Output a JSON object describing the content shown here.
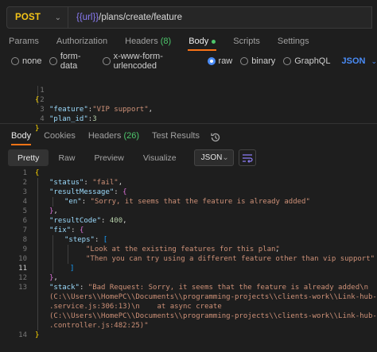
{
  "request": {
    "method": "POST",
    "url_variable": "{{url}}",
    "url_path": "/plans/create/feature"
  },
  "request_tabs": [
    {
      "label": "Params"
    },
    {
      "label": "Authorization"
    },
    {
      "label": "Headers",
      "count": "(8)"
    },
    {
      "label": "Body",
      "active": true
    },
    {
      "label": "Scripts"
    },
    {
      "label": "Settings"
    }
  ],
  "body_types": [
    "none",
    "form-data",
    "x-www-form-urlencoded",
    "raw",
    "binary",
    "GraphQL"
  ],
  "body_type_selected": "raw",
  "body_format": "JSON",
  "request_body": [
    {
      "n": "1",
      "t": "{"
    },
    {
      "n": "2",
      "key": "\"feature\"",
      "val": "\"VIP support\"",
      "end": ","
    },
    {
      "n": "3",
      "key": "\"plan_id\"",
      "val": "3",
      "end": ""
    },
    {
      "n": "4",
      "t": "}"
    }
  ],
  "response_tabs": [
    {
      "label": "Body",
      "active": true
    },
    {
      "label": "Cookies"
    },
    {
      "label": "Headers",
      "count": "(26)"
    },
    {
      "label": "Test Results"
    }
  ],
  "view_modes": [
    "Pretty",
    "Raw",
    "Preview",
    "Visualize"
  ],
  "view_format": "JSON",
  "response_body": {
    "ln": [
      "1",
      "2",
      "3",
      "4",
      "5",
      "6",
      "7",
      "8",
      "9",
      "10",
      "11",
      "12",
      "13",
      "",
      "",
      "",
      "",
      "14"
    ],
    "status_key": "\"status\"",
    "status_val": "\"fail\"",
    "rm_key": "\"resultMessage\"",
    "en_key": "\"en\"",
    "en_val": "\"Sorry, it seems that the feature is already added\"",
    "rc_key": "\"resultCode\"",
    "rc_val": "400",
    "fix_key": "\"fix\"",
    "steps_key": "\"steps\"",
    "step1": "\"Look at the existing features for this plan\"",
    "step2": "\"Then you can try using a different feature other than vip support\"",
    "stack_key": "\"stack\"",
    "stack_1": "\"Bad Request: Sorry, it seems that the feature is already added\\n    at Ob",
    "stack_2": "(C:\\\\Users\\\\HomePC\\\\Documents\\\\programming-projects\\\\clients-work\\\\Link-hub-afr",
    "stack_3": ".service.js:306:13)\\n    at async create",
    "stack_4": "(C:\\\\Users\\\\HomePC\\\\Documents\\\\programming-projects\\\\clients-work\\\\Link-hub-afr",
    "stack_5": ".controller.js:482:25)\""
  }
}
